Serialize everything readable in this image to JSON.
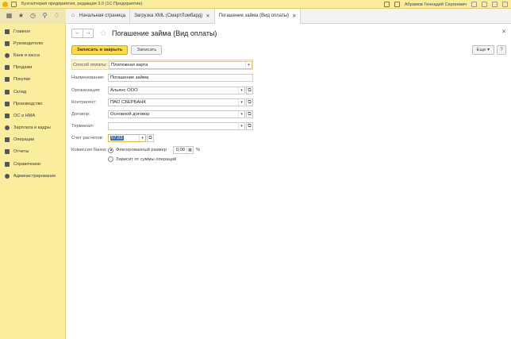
{
  "window": {
    "title": "Бухгалтерия предприятия, редакция 3.0  (1С:Предприятие)",
    "user": "Абрамов Геннадий Сергеевич"
  },
  "tabs": [
    {
      "label": "Начальная страница",
      "closable": false
    },
    {
      "label": "Загрузка XML (СмартЛомбард)",
      "closable": true
    },
    {
      "label": "Погашение займа (Вид оплаты)",
      "closable": true,
      "active": true
    }
  ],
  "sidebar": {
    "items": [
      {
        "label": "Главное",
        "icon": "menu-icon"
      },
      {
        "label": "Руководителю",
        "icon": "chart-icon"
      },
      {
        "label": "Банк и касса",
        "icon": "bank-icon"
      },
      {
        "label": "Продажи",
        "icon": "sales-icon"
      },
      {
        "label": "Покупки",
        "icon": "cart-icon"
      },
      {
        "label": "Склад",
        "icon": "warehouse-icon"
      },
      {
        "label": "Производство",
        "icon": "factory-icon"
      },
      {
        "label": "ОС и НМА",
        "icon": "assets-icon"
      },
      {
        "label": "Зарплата и кадры",
        "icon": "people-icon"
      },
      {
        "label": "Операции",
        "icon": "operations-icon"
      },
      {
        "label": "Отчеты",
        "icon": "reports-icon"
      },
      {
        "label": "Справочники",
        "icon": "book-icon"
      },
      {
        "label": "Администрирование",
        "icon": "gear-icon"
      }
    ]
  },
  "form": {
    "title": "Погашение займа (Вид оплаты)",
    "save_close_label": "Записать и закрыть",
    "save_label": "Записать",
    "more_label": "Еще",
    "more_arrow": "▾",
    "help_label": "?",
    "fields": {
      "payment_method": {
        "label": "Способ оплаты:",
        "value": "Платежная карта"
      },
      "name": {
        "label": "Наименование:",
        "value": "Погашение займа"
      },
      "organization": {
        "label": "Организация:",
        "value": "Альянс ООО"
      },
      "counterparty": {
        "label": "Контрагент:",
        "value": "ПАО СБЕРБАНК"
      },
      "contract": {
        "label": "Договор:",
        "value": "Основной договор"
      },
      "terminal": {
        "label": "Терминал:",
        "value": ""
      },
      "account": {
        "label": "Счет расчетов:",
        "value": "57.03"
      },
      "commission": {
        "label": "Комиссия банка:",
        "fixed_label": "Фиксированный размер",
        "fixed_value": "0,00",
        "unit": "%",
        "depends_label": "Зависит от суммы операций",
        "selected": "fixed"
      }
    }
  }
}
